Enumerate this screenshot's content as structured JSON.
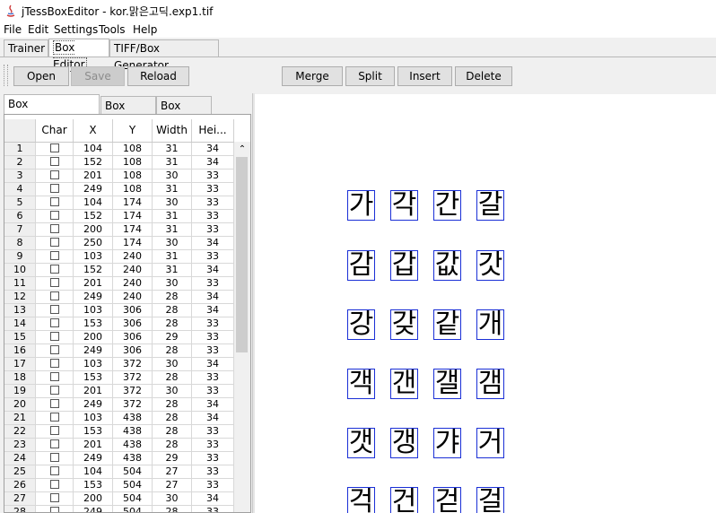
{
  "window": {
    "title": "jTessBoxEditor - kor.맑은고딕.exp1.tif"
  },
  "menu": [
    "File",
    "Edit",
    "Settings",
    "Tools",
    "Help"
  ],
  "main_tabs": [
    {
      "label": "Trainer",
      "active": false
    },
    {
      "label": "Box Editor",
      "active": true
    },
    {
      "label": "TIFF/Box Generator",
      "active": false
    }
  ],
  "toolbar": {
    "open": "Open",
    "save": "Save",
    "reload": "Reload",
    "merge": "Merge",
    "split": "Split",
    "insert": "Insert",
    "delete": "Delete"
  },
  "sub_tabs": [
    {
      "label": "Box Coordinates",
      "active": true
    },
    {
      "label": "Box Data",
      "active": false
    },
    {
      "label": "Box View",
      "active": false
    }
  ],
  "table": {
    "columns": [
      "",
      "Char",
      "X",
      "Y",
      "Width",
      "Hei..."
    ],
    "rows": [
      [
        "1",
        "104",
        "108",
        "31",
        "34"
      ],
      [
        "2",
        "152",
        "108",
        "31",
        "34"
      ],
      [
        "3",
        "201",
        "108",
        "30",
        "33"
      ],
      [
        "4",
        "249",
        "108",
        "31",
        "33"
      ],
      [
        "5",
        "104",
        "174",
        "30",
        "33"
      ],
      [
        "6",
        "152",
        "174",
        "31",
        "33"
      ],
      [
        "7",
        "200",
        "174",
        "31",
        "33"
      ],
      [
        "8",
        "250",
        "174",
        "30",
        "34"
      ],
      [
        "9",
        "103",
        "240",
        "31",
        "33"
      ],
      [
        "10",
        "152",
        "240",
        "31",
        "34"
      ],
      [
        "11",
        "201",
        "240",
        "30",
        "33"
      ],
      [
        "12",
        "249",
        "240",
        "28",
        "34"
      ],
      [
        "13",
        "103",
        "306",
        "28",
        "34"
      ],
      [
        "14",
        "153",
        "306",
        "28",
        "33"
      ],
      [
        "15",
        "200",
        "306",
        "29",
        "33"
      ],
      [
        "16",
        "249",
        "306",
        "28",
        "33"
      ],
      [
        "17",
        "103",
        "372",
        "30",
        "34"
      ],
      [
        "18",
        "153",
        "372",
        "28",
        "33"
      ],
      [
        "19",
        "201",
        "372",
        "30",
        "33"
      ],
      [
        "20",
        "249",
        "372",
        "28",
        "34"
      ],
      [
        "21",
        "103",
        "438",
        "28",
        "34"
      ],
      [
        "22",
        "153",
        "438",
        "28",
        "33"
      ],
      [
        "23",
        "201",
        "438",
        "28",
        "33"
      ],
      [
        "24",
        "249",
        "438",
        "29",
        "33"
      ],
      [
        "25",
        "104",
        "504",
        "27",
        "33"
      ],
      [
        "26",
        "153",
        "504",
        "27",
        "33"
      ],
      [
        "27",
        "200",
        "504",
        "30",
        "34"
      ],
      [
        "28",
        "249",
        "504",
        "28",
        "33"
      ]
    ]
  },
  "glyphs": [
    "가",
    "각",
    "간",
    "갈",
    "감",
    "갑",
    "값",
    "갓",
    "강",
    "갖",
    "같",
    "개",
    "객",
    "갠",
    "갤",
    "갬",
    "갯",
    "갱",
    "갸",
    "거",
    "걱",
    "건",
    "걷",
    "걸"
  ],
  "colors": {
    "box_border": "#1a2fd6"
  }
}
